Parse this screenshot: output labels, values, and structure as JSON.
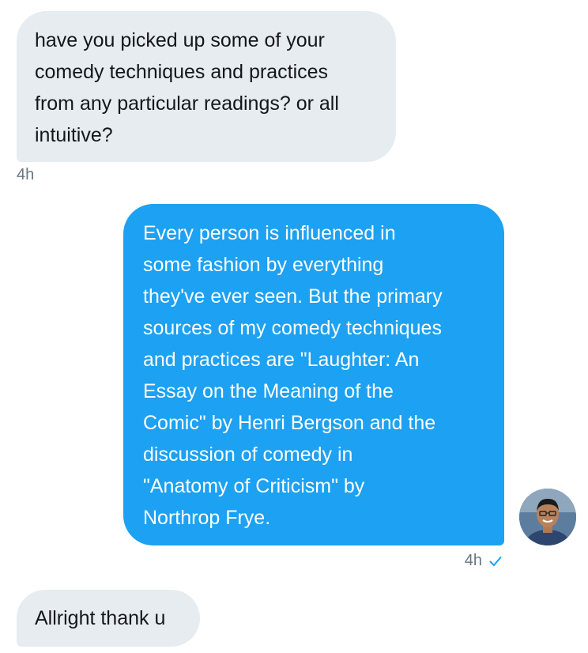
{
  "conversation": {
    "messages": [
      {
        "direction": "received",
        "text": "have you picked up some of your\ncomedy techniques and practices\nfrom any particular readings? or all\nintuitive?",
        "time": "4h"
      },
      {
        "direction": "sent",
        "text": "Every person is influenced in\nsome fashion by everything\nthey've ever seen. But the primary\nsources of my comedy techniques\nand practices are \"Laughter: An\nEssay on the Meaning of the\nComic\" by Henri Bergson and the\ndiscussion of comedy in\n\"Anatomy of Criticism\" by\nNorthrop Frye.",
        "time": "4h",
        "status_icon": "check-icon"
      },
      {
        "direction": "received",
        "text": "Allright thank u"
      }
    ]
  },
  "colors": {
    "sent_bubble": "#1da1f2",
    "received_bubble": "#e6ecf0",
    "timestamp": "#657786",
    "check": "#1da1f2"
  },
  "icons": {
    "avatar": "user-avatar",
    "read_status": "check-icon"
  }
}
